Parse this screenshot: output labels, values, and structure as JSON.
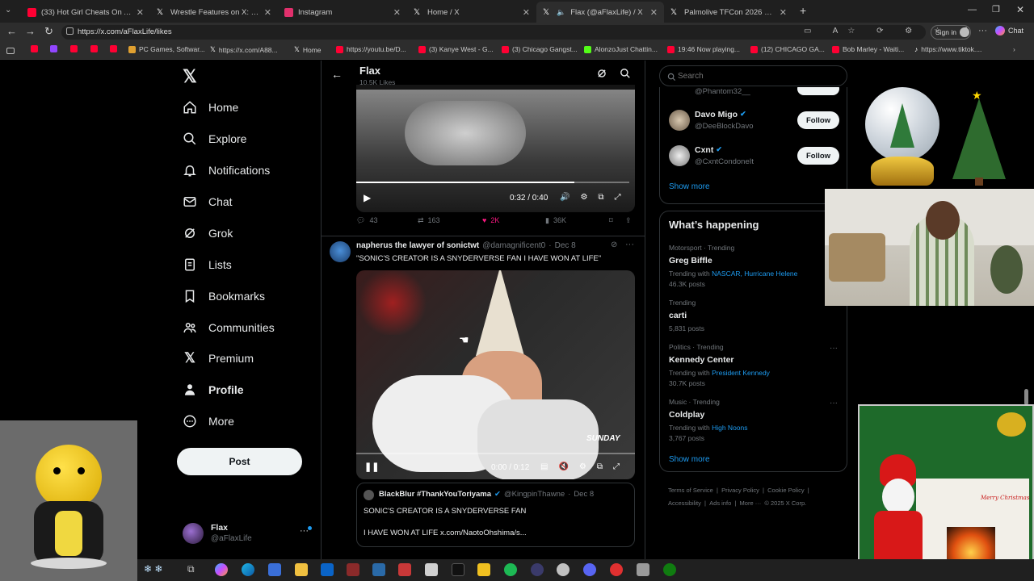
{
  "browser": {
    "tabs": [
      {
        "label": "(33) Hot Girl Cheats On Asian Boyf",
        "color": "#ff0033"
      },
      {
        "label": "Wrestle Features on X: \"\"Elias snuc",
        "color": "#ffffff"
      },
      {
        "label": "Instagram",
        "color": "#e1306c"
      },
      {
        "label": "Home / X",
        "color": "#ffffff"
      },
      {
        "label": "Flax (@aFlaxLife) / X",
        "color": "#ffffff"
      },
      {
        "label": "Palmolive TFCon 2026 on X: \"http:",
        "color": "#ffffff"
      }
    ],
    "url": "https://x.com/aFlaxLife/likes",
    "sign_in": "Sign in",
    "chat": "Chat",
    "bookmarks": [
      {
        "label": "",
        "color": "#ff0033"
      },
      {
        "label": "",
        "color": "#9146ff"
      },
      {
        "label": "",
        "color": "#ff0033"
      },
      {
        "label": "",
        "color": "#ff0033"
      },
      {
        "label": "",
        "color": "#ff0033"
      },
      {
        "label": "PC Games, Softwar...",
        "color": "#e0a030"
      },
      {
        "label": "https://x.com/A88...",
        "color": "#ffffff"
      },
      {
        "label": "Home",
        "color": "#ffffff"
      },
      {
        "label": "https://youtu.be/D...",
        "color": "#ff0033"
      },
      {
        "label": "(3) Kanye West - G...",
        "color": "#ff0033"
      },
      {
        "label": "(3) Chicago Gangst...",
        "color": "#ff0033"
      },
      {
        "label": "AlonzoJust Chattin...",
        "color": "#53fc18"
      },
      {
        "label": "19:46 Now playing...",
        "color": "#ff0033"
      },
      {
        "label": "(12) CHICAGO GA...",
        "color": "#ff0033"
      },
      {
        "label": "Bob Marley - Waiti...",
        "color": "#ff0033"
      },
      {
        "label": "https://www.tiktok....",
        "color": "#ffffff"
      }
    ]
  },
  "sidebar": {
    "items": [
      {
        "label": "Home",
        "icon": "home-icon"
      },
      {
        "label": "Explore",
        "icon": "search-icon"
      },
      {
        "label": "Notifications",
        "icon": "bell-icon"
      },
      {
        "label": "Chat",
        "icon": "mail-icon"
      },
      {
        "label": "Grok",
        "icon": "grok-icon"
      },
      {
        "label": "Lists",
        "icon": "list-icon"
      },
      {
        "label": "Bookmarks",
        "icon": "bookmark-icon"
      },
      {
        "label": "Communities",
        "icon": "people-icon"
      },
      {
        "label": "Premium",
        "icon": "x-logo-icon"
      },
      {
        "label": "Profile",
        "icon": "person-icon"
      },
      {
        "label": "More",
        "icon": "more-circle-icon"
      }
    ],
    "post_label": "Post",
    "account": {
      "name": "Flax",
      "handle": "@aFlaxLife"
    }
  },
  "header": {
    "title": "Flax",
    "subtitle": "10.5K Likes"
  },
  "tweet1": {
    "video_time": "0:32 / 0:40",
    "progress": 0.8,
    "replies": "43",
    "reposts": "163",
    "likes": "2K",
    "views": "36K"
  },
  "tweet2": {
    "name": "napherus the lawyer of sonictwt",
    "handle": "@damagnificent0",
    "date": "Dec 8",
    "text": "\"SONIC'S CREATOR IS A SNYDERVERSE FAN I HAVE WON AT LIFE\"",
    "video_caption": "SUNDAY",
    "video_time": "0:00 / 0:12",
    "quote": {
      "name": "BlackBlur #ThankYouToriyama",
      "handle": "@KingpinThawne",
      "date": "Dec 8",
      "line1": "SONIC'S CREATOR IS A SNYDERVERSE FAN",
      "line2": "I HAVE WON AT LIFE x.com/NaotoOhshima/s..."
    }
  },
  "search": {
    "placeholder": "Search"
  },
  "who_to_follow": {
    "partial_handle": "@Phantom32__",
    "accounts": [
      {
        "name": "Davo Migo",
        "handle": "@DeeBlockDavo",
        "button": "Follow"
      },
      {
        "name": "Cxnt",
        "handle": "@CxntCondoneIt",
        "button": "Follow"
      }
    ],
    "show_more": "Show more"
  },
  "whats_happening": {
    "title": "What’s happening",
    "trends": [
      {
        "category": "Motorsport · Trending",
        "title": "Greg Biffle",
        "with_prefix": "Trending with",
        "with_links": "NASCAR, Hurricane Helene",
        "posts": "46.3K posts"
      },
      {
        "category": "Trending",
        "title": "carti",
        "with_prefix": "",
        "with_links": "",
        "posts": "5,831 posts"
      },
      {
        "category": "Politics · Trending",
        "title": "Kennedy Center",
        "with_prefix": "Trending with",
        "with_links": "President Kennedy",
        "posts": "30.7K posts"
      },
      {
        "category": "Music · Trending",
        "title": "Coldplay",
        "with_prefix": "Trending with",
        "with_links": "High Noons",
        "posts": "3,767 posts"
      }
    ],
    "show_more": "Show more"
  },
  "footer": {
    "links": [
      "Terms of Service",
      "Privacy Policy",
      "Cookie Policy",
      "Accessibility",
      "Ads info",
      "More ···",
      "© 2025 X Corp."
    ]
  },
  "overlays": {
    "card_text": "Merry Christmas"
  },
  "colors": {
    "accent": "#1d9bf0",
    "like": "#f91880",
    "bg": "#000000",
    "border": "#2f3336"
  }
}
